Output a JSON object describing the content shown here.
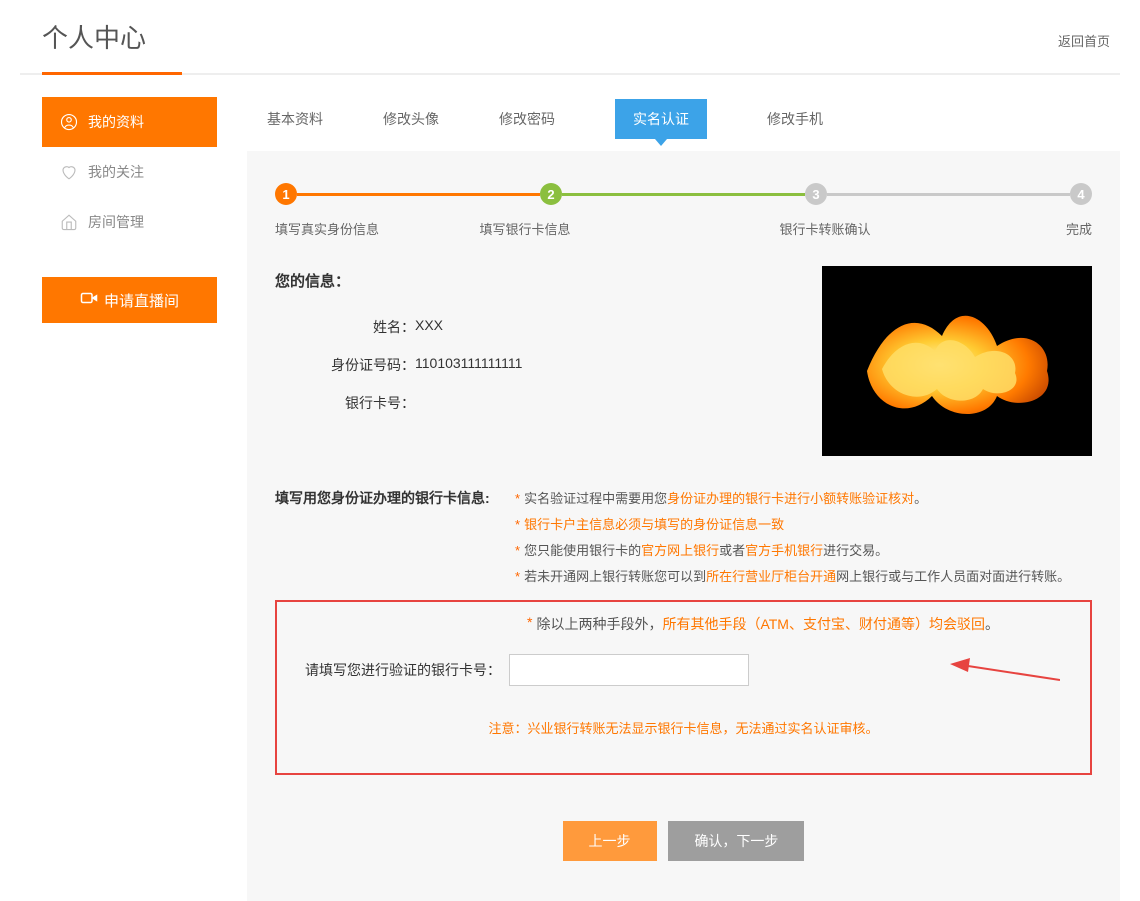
{
  "header": {
    "title": "个人中心",
    "back_home": "返回首页"
  },
  "sidebar": {
    "items": [
      {
        "label": "我的资料",
        "icon": "user-icon"
      },
      {
        "label": "我的关注",
        "icon": "heart-icon"
      },
      {
        "label": "房间管理",
        "icon": "home-icon"
      }
    ],
    "apply_live": "申请直播间"
  },
  "tabs": [
    {
      "label": "基本资料"
    },
    {
      "label": "修改头像"
    },
    {
      "label": "修改密码"
    },
    {
      "label": "实名认证"
    },
    {
      "label": "修改手机"
    }
  ],
  "steps": [
    {
      "num": "1",
      "label": "填写真实身份信息"
    },
    {
      "num": "2",
      "label": "填写银行卡信息"
    },
    {
      "num": "3",
      "label": "银行卡转账确认"
    },
    {
      "num": "4",
      "label": "完成"
    }
  ],
  "info": {
    "title": "您的信息：",
    "name_label": "姓名：",
    "name_value": "XXX",
    "id_label": "身份证号码：",
    "id_value": "110103111111111",
    "bank_label": "银行卡号："
  },
  "bank_section": {
    "header": "填写用您身份证办理的银行卡信息:",
    "rules": [
      {
        "pre": "实名验证过程中需要用您",
        "hl": "身份证办理的银行卡进行小额转账验证核对",
        "post": "。"
      },
      {
        "pre": "",
        "hl": "银行卡户主信息必须与填写的身份证信息一致",
        "post": ""
      },
      {
        "pre": "您只能使用银行卡的",
        "hl": "官方网上银行",
        "mid": "或者",
        "hl2": "官方手机银行",
        "post": "进行交易。"
      },
      {
        "pre": "若未开通网上银行转账您可以到",
        "hl": "所在行营业厅柜台开通",
        "post": "网上银行或与工作人员面对面进行转账。"
      },
      {
        "pre": "除以上两种手段外，",
        "hl": "所有其他手段（ATM、支付宝、财付通等）均会驳回",
        "post": "。"
      }
    ],
    "input_label": "请填写您进行验证的银行卡号：",
    "input_value": "",
    "note_label": "注意：",
    "note_text": "兴业银行转账无法显示银行卡信息，无法通过实名认证审核。"
  },
  "buttons": {
    "prev": "上一步",
    "next": "确认，下一步"
  }
}
